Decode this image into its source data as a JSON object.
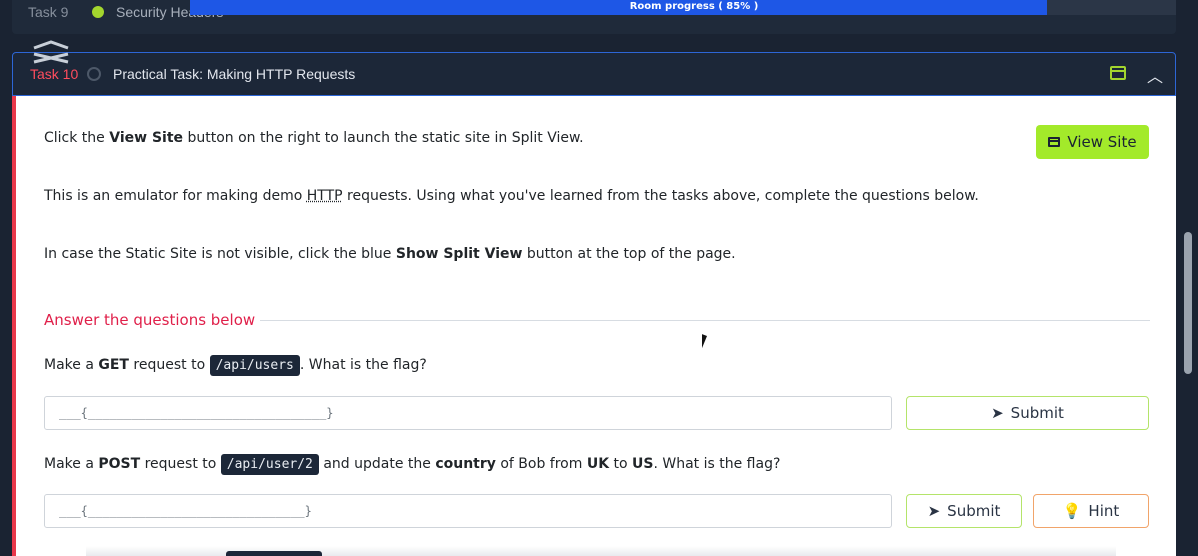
{
  "progress": {
    "label": "Room progress ( 85% )",
    "value": 0.85
  },
  "previous_task": {
    "label": "Task 9",
    "title": "Security Headers"
  },
  "task": {
    "number": "Task 10",
    "title": "Practical Task: Making HTTP Requests"
  },
  "intro": {
    "line1_pre": "Click the ",
    "line1_bold": "View Site",
    "line1_post": " button on the right to launch the static site in Split View.",
    "line2_pre": "This is an emulator for making demo ",
    "line2_abbr": "HTTP",
    "line2_post": " requests. Using what you've learned from the tasks above, complete the questions below.",
    "line3_pre": "In case the Static Site is not visible, click the blue ",
    "line3_bold": "Show Split View",
    "line3_post": " button at the top of the page."
  },
  "view_site_button": "View Site",
  "answer_heading": "Answer the questions below",
  "questions": [
    {
      "pre": "Make a ",
      "method": "GET",
      "mid": " request to ",
      "path": "/api/users",
      "post": ". What is the flag?",
      "input_value": "___{_________________________________}",
      "submit_label": "Submit"
    },
    {
      "pre": "Make a ",
      "method": "POST",
      "mid": " request to ",
      "path": "/api/user/2",
      "post_a": " and update the ",
      "field": "country",
      "post_b": " of Bob from ",
      "from": "UK",
      "post_c": " to ",
      "to": "US",
      "post_d": ". What is the flag?",
      "input_value": "___{______________________________}",
      "submit_label": "Submit",
      "hint_label": "Hint"
    }
  ]
}
